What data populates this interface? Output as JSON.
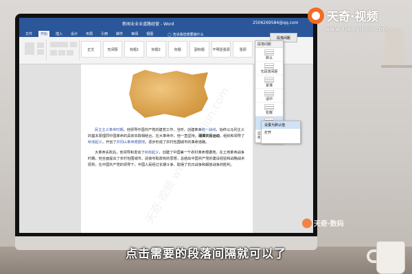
{
  "window": {
    "title": "新闻业业业道路经营 - Word",
    "account": "2506269584@qq.com"
  },
  "tabs": [
    {
      "label": "文件"
    },
    {
      "label": "开始",
      "active": true
    },
    {
      "label": "插入"
    },
    {
      "label": "设计"
    },
    {
      "label": "布局"
    },
    {
      "label": "引用"
    },
    {
      "label": "邮件"
    },
    {
      "label": "审阅"
    },
    {
      "label": "视图"
    }
  ],
  "tell_me": "告诉我您想要做什么",
  "style_gallery": [
    "正文",
    "无间隔",
    "标题1",
    "标题2",
    "标题",
    "副标题",
    "不明显强调",
    "强调"
  ],
  "document": {
    "paragraphs": [
      {
        "spans": [
          {
            "text": "民主主义革命时期",
            "class": "link"
          },
          {
            "text": "，他领导中国共产党的建党工作，当时，创建革命"
          },
          {
            "text": "统一战线",
            "class": "link"
          },
          {
            "text": "，始终以马列主义的基本原理同中国革命的具体实践相结合，在大革命中，他一直坚持，"
          },
          {
            "text": "湘潭农民运动",
            "class": "bold"
          },
          {
            "text": "，组织和领导了"
          },
          {
            "text": "秋收起义",
            "class": "link"
          },
          {
            "text": "，开创了"
          },
          {
            "text": "井冈山革命根据地",
            "class": "link"
          },
          {
            "text": "，逐步形成了农村包围城市的革命道路。"
          }
        ]
      },
      {
        "spans": [
          {
            "text": "大革命失败后，他领导和发动了"
          },
          {
            "text": "秋收起义",
            "class": "link"
          },
          {
            "text": "，创建了中国第一个农村革命根据地。在土地革命战争时期，他全面提出了农村包围城市、武装夺取政权的思想，总结出中国共产党的建设经验和战略战术原则，在中国共产党的领导下，中国人民经过长期斗争，取得了抗日战争和解放战争的胜利。"
          }
        ]
      }
    ]
  },
  "spacing_menu": {
    "header": "段落间距",
    "top_button": "段落间距",
    "items": [
      {
        "label": "默认"
      },
      {
        "label": "无段落间距"
      },
      {
        "label": "紧凑"
      },
      {
        "label": "适中"
      },
      {
        "label": "松散"
      },
      {
        "label": "双倍",
        "highlight": true
      }
    ],
    "footer": "自定义段落间距..."
  },
  "submenu": [
    {
      "label": "设置为默认值",
      "highlight": true
    },
    {
      "label": "打开"
    }
  ],
  "brand": {
    "name": "天奇·视频",
    "url": "www.tianqijun.com"
  },
  "brand2": {
    "name": "天奇·数码"
  },
  "watermark": "天奇·视频 www.tianqijun.com",
  "subtitle": "点击需要的段落间隔就可以了"
}
